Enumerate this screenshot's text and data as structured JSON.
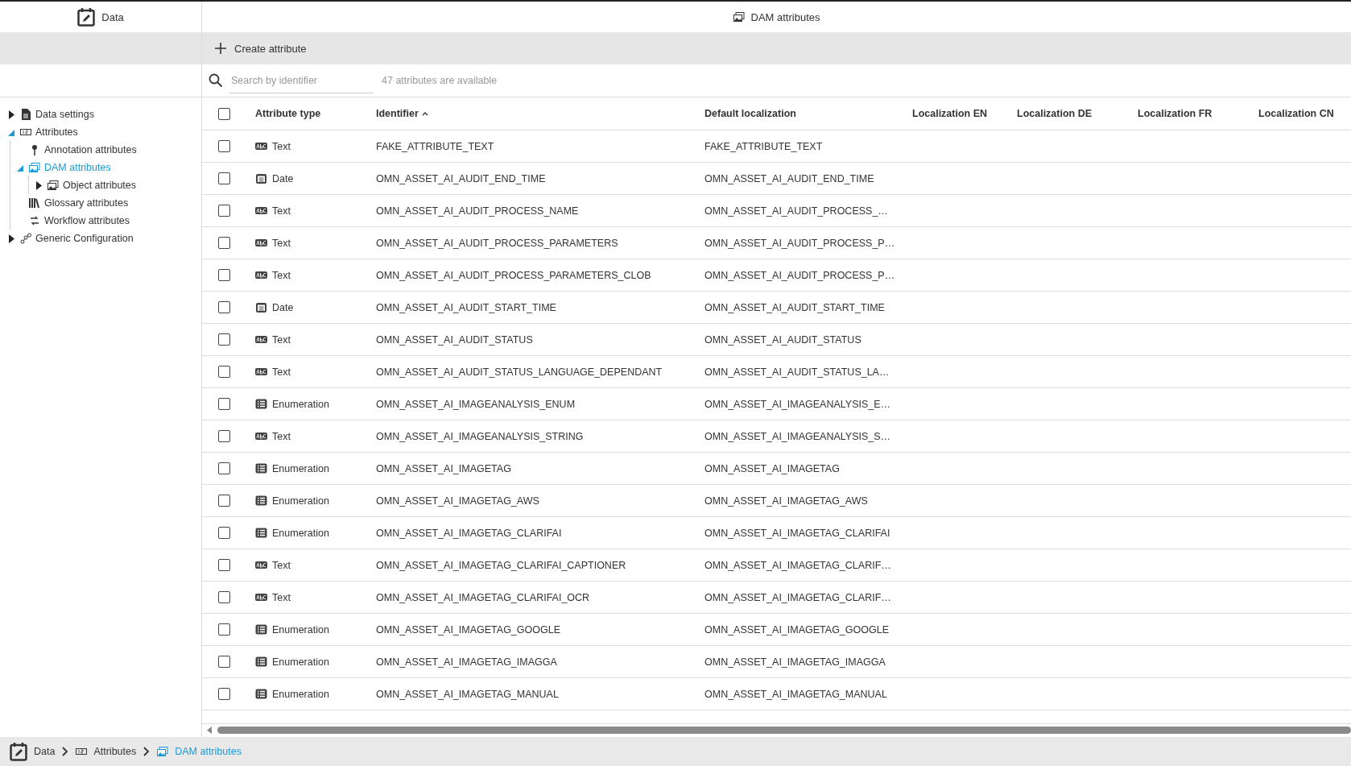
{
  "sidebar": {
    "title": "Data",
    "tree": [
      {
        "label": "Data settings",
        "kind": "settings",
        "expanded": false,
        "selected": false
      },
      {
        "label": "Attributes",
        "kind": "attributes",
        "expanded": true,
        "selected": false,
        "children": [
          {
            "label": "Annotation attributes",
            "kind": "annotation",
            "selected": false
          },
          {
            "label": "DAM attributes",
            "kind": "dam",
            "expanded": true,
            "selected": true,
            "children": [
              {
                "label": "Object attributes",
                "kind": "dam",
                "expanded": false,
                "selected": false
              }
            ]
          },
          {
            "label": "Glossary attributes",
            "kind": "glossary",
            "selected": false
          },
          {
            "label": "Workflow attributes",
            "kind": "workflow",
            "selected": false
          }
        ]
      },
      {
        "label": "Generic Configuration",
        "kind": "config",
        "expanded": false,
        "selected": false
      }
    ]
  },
  "main": {
    "title": "DAM attributes",
    "create_button": "Create attribute",
    "search": {
      "placeholder": "Search by identifier"
    },
    "count": "47 attributes are available"
  },
  "table": {
    "select_all": {
      "checked": false
    },
    "columns": [
      {
        "label": "Attribute type"
      },
      {
        "label": "Identifier",
        "sort_ascending": true
      },
      {
        "label": "Default localization"
      },
      {
        "label": "Localization EN"
      },
      {
        "label": "Localization DE"
      },
      {
        "label": "Localization FR"
      },
      {
        "label": "Localization CN"
      }
    ],
    "rows": [
      {
        "checked": false,
        "kind": "text",
        "type": "Text",
        "identifier": "FAKE_ATTRIBUTE_TEXT",
        "default": "FAKE_ATTRIBUTE_TEXT"
      },
      {
        "checked": false,
        "kind": "date",
        "type": "Date",
        "identifier": "OMN_ASSET_AI_AUDIT_END_TIME",
        "default": "OMN_ASSET_AI_AUDIT_END_TIME"
      },
      {
        "checked": false,
        "kind": "text",
        "type": "Text",
        "identifier": "OMN_ASSET_AI_AUDIT_PROCESS_NAME",
        "default": "OMN_ASSET_AI_AUDIT_PROCESS_…"
      },
      {
        "checked": false,
        "kind": "text",
        "type": "Text",
        "identifier": "OMN_ASSET_AI_AUDIT_PROCESS_PARAMETERS",
        "default": "OMN_ASSET_AI_AUDIT_PROCESS_P…"
      },
      {
        "checked": false,
        "kind": "text",
        "type": "Text",
        "identifier": "OMN_ASSET_AI_AUDIT_PROCESS_PARAMETERS_CLOB",
        "default": "OMN_ASSET_AI_AUDIT_PROCESS_P…"
      },
      {
        "checked": false,
        "kind": "date",
        "type": "Date",
        "identifier": "OMN_ASSET_AI_AUDIT_START_TIME",
        "default": "OMN_ASSET_AI_AUDIT_START_TIME"
      },
      {
        "checked": false,
        "kind": "text",
        "type": "Text",
        "identifier": "OMN_ASSET_AI_AUDIT_STATUS",
        "default": "OMN_ASSET_AI_AUDIT_STATUS"
      },
      {
        "checked": false,
        "kind": "text",
        "type": "Text",
        "identifier": "OMN_ASSET_AI_AUDIT_STATUS_LANGUAGE_DEPENDANT",
        "default": "OMN_ASSET_AI_AUDIT_STATUS_LA…"
      },
      {
        "checked": false,
        "kind": "enumeration",
        "type": "Enumeration",
        "identifier": "OMN_ASSET_AI_IMAGEANALYSIS_ENUM",
        "default": "OMN_ASSET_AI_IMAGEANALYSIS_E…"
      },
      {
        "checked": false,
        "kind": "text",
        "type": "Text",
        "identifier": "OMN_ASSET_AI_IMAGEANALYSIS_STRING",
        "default": "OMN_ASSET_AI_IMAGEANALYSIS_S…"
      },
      {
        "checked": false,
        "kind": "enumeration",
        "type": "Enumeration",
        "identifier": "OMN_ASSET_AI_IMAGETAG",
        "default": "OMN_ASSET_AI_IMAGETAG"
      },
      {
        "checked": false,
        "kind": "enumeration",
        "type": "Enumeration",
        "identifier": "OMN_ASSET_AI_IMAGETAG_AWS",
        "default": "OMN_ASSET_AI_IMAGETAG_AWS"
      },
      {
        "checked": false,
        "kind": "enumeration",
        "type": "Enumeration",
        "identifier": "OMN_ASSET_AI_IMAGETAG_CLARIFAI",
        "default": "OMN_ASSET_AI_IMAGETAG_CLARIFAI"
      },
      {
        "checked": false,
        "kind": "text",
        "type": "Text",
        "identifier": "OMN_ASSET_AI_IMAGETAG_CLARIFAI_CAPTIONER",
        "default": "OMN_ASSET_AI_IMAGETAG_CLARIF…"
      },
      {
        "checked": false,
        "kind": "text",
        "type": "Text",
        "identifier": "OMN_ASSET_AI_IMAGETAG_CLARIFAI_OCR",
        "default": "OMN_ASSET_AI_IMAGETAG_CLARIF…"
      },
      {
        "checked": false,
        "kind": "enumeration",
        "type": "Enumeration",
        "identifier": "OMN_ASSET_AI_IMAGETAG_GOOGLE",
        "default": "OMN_ASSET_AI_IMAGETAG_GOOGLE"
      },
      {
        "checked": false,
        "kind": "enumeration",
        "type": "Enumeration",
        "identifier": "OMN_ASSET_AI_IMAGETAG_IMAGGA",
        "default": "OMN_ASSET_AI_IMAGETAG_IMAGGA"
      },
      {
        "checked": false,
        "kind": "enumeration",
        "type": "Enumeration",
        "identifier": "OMN_ASSET_AI_IMAGETAG_MANUAL",
        "default": "OMN_ASSET_AI_IMAGETAG_MANUAL"
      }
    ]
  },
  "breadcrumb": [
    {
      "label": "Data",
      "kind": "root",
      "selected": false
    },
    {
      "label": "Attributes",
      "kind": "attributes",
      "selected": false
    },
    {
      "label": "DAM attributes",
      "kind": "dam",
      "selected": true
    }
  ]
}
